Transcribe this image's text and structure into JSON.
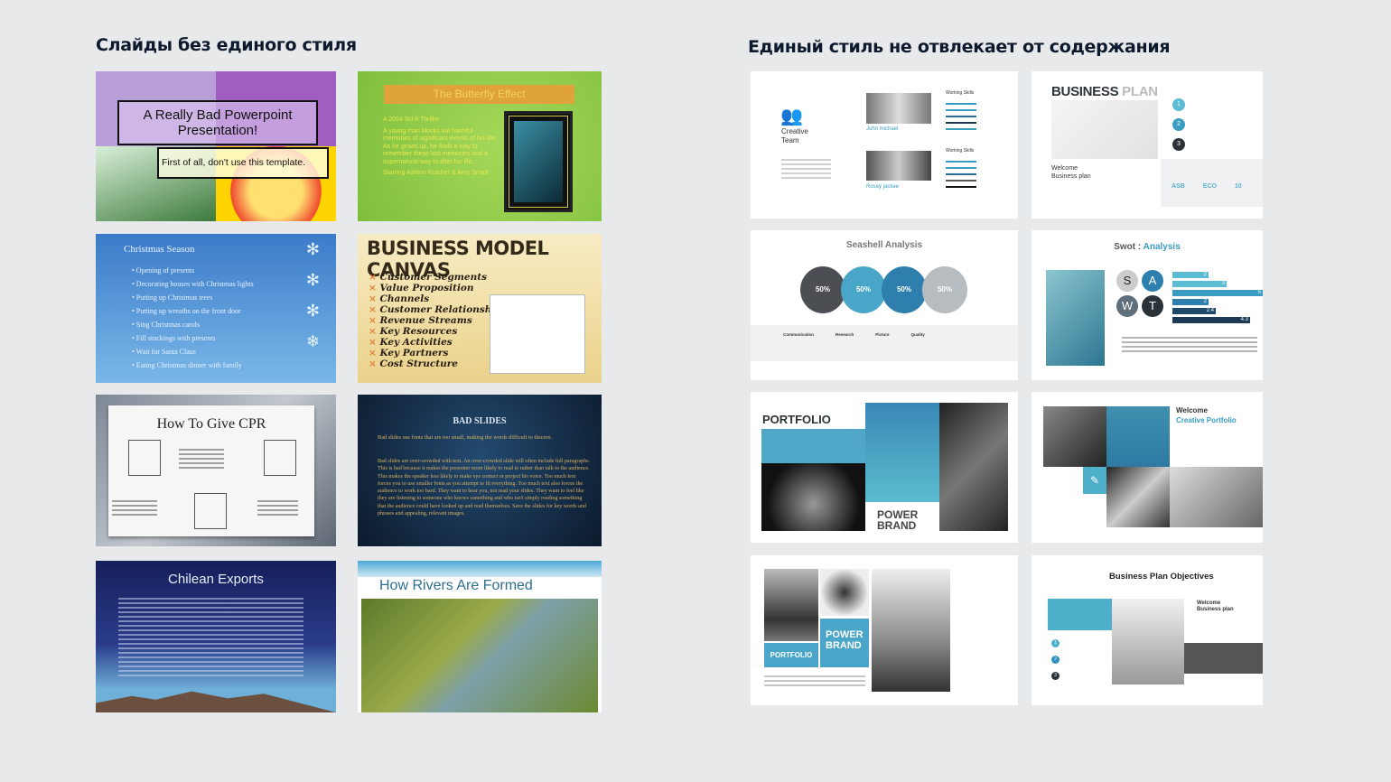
{
  "left": {
    "heading": "Слайды без единого стиля",
    "slides": {
      "bad_ppt": {
        "title": "A Really Bad Powerpoint Presentation!",
        "subtitle": "First of all, don't use this template."
      },
      "butterfly": {
        "title": "The Butterfly Effect",
        "bullets": [
          "A 2004 Sci-fi Thriller",
          "A young man blocks out harmful memories of significant events of his life. As he grows up, he finds a way to remember these lost memories and a supernatural way to alter his life.",
          "Starring Ashton Kutcher & Amy Smart"
        ]
      },
      "christmas": {
        "title": "Christmas Season",
        "bullets": [
          "Opening of presents",
          "Decorating houses with Christmas lights",
          "Putting up Christmas trees",
          "Putting up wreaths on the front door",
          "Sing Christmas carols",
          "Fill stockings with presents",
          "Wait for Santa Claus",
          "Eating Christmas dinner with family"
        ]
      },
      "bmc": {
        "title": "BUSINESS MODEL CANVAS",
        "items": [
          "Customer Segments",
          "Value Proposition",
          "Channels",
          "Customer Relationships",
          "Revenue Streams",
          "Key Resources",
          "Key Activities",
          "Key Partners",
          "Cost Structure"
        ]
      },
      "cpr": {
        "title": "How To Give CPR"
      },
      "bad_slides": {
        "title": "BAD SLIDES",
        "bullets": [
          "Bad slides use fonts that are too small, making the words difficult to discern.",
          "Bad slides are over-crowded with text. An over-crowded slide will often include full paragraphs. This is bad because it makes the presenter more likely to read to rather than talk to the audience. This makes the speaker less likely to make eye contact or project his voice. Too much text forces you to use smaller fonts as you attempt to fit everything. Too much text also forces the audience to work too hard. They want to hear you, not read your slides. They want to feel like they are listening to someone who knows something and who isn't simply reading something that the audience could have looked up and read themselves. Save the slides for key words and phrases and appealing, relevant images."
        ]
      },
      "chilean": {
        "title": "Chilean Exports"
      },
      "rivers": {
        "title": "How Rivers Are Formed"
      }
    }
  },
  "right": {
    "heading": "Единый стиль не отвлекает от содержания",
    "slides": {
      "team": {
        "title": "Creative Team",
        "people": [
          "John michael",
          "Rosey jackee"
        ],
        "skills_label": "Working Skills"
      },
      "business_plan": {
        "title_a": "BUSINESS",
        "title_b": "PLAN",
        "welcome": "Welcome",
        "subtitle": "Business plan",
        "steps": [
          "1",
          "2",
          "3"
        ],
        "stats": [
          "ASB",
          "ECO",
          "10"
        ]
      },
      "seashell": {
        "title": "Seashell Analysis",
        "circles": [
          "50%",
          "50%",
          "50%",
          "50%"
        ],
        "labels": [
          "Communication",
          "Research",
          "Picture",
          "Quality"
        ]
      },
      "swot": {
        "title_a": "Swot :",
        "title_b": "Analysis",
        "letters": [
          "S",
          "A",
          "W",
          "T"
        ],
        "values": [
          "2",
          "3",
          "5",
          "2",
          "2.4",
          "4.3"
        ]
      },
      "portfolio": {
        "title": "PORTFOLIO",
        "brand": "POWER BRAND"
      },
      "welcome_portfolio": {
        "welcome": "Welcome",
        "sub": "Creative Portfolio"
      },
      "portfolio2": {
        "label": "PORTFOLIO",
        "brand": "POWER BRAND"
      },
      "objectives": {
        "title": "Business Plan Objectives",
        "welcome": "Welcome",
        "sub": "Business plan",
        "steps": [
          "1",
          "2",
          "3"
        ]
      }
    }
  },
  "colors": {
    "accent": "#3a9cc0",
    "dark": "#2b3338",
    "heading": "#0d1a2e"
  }
}
